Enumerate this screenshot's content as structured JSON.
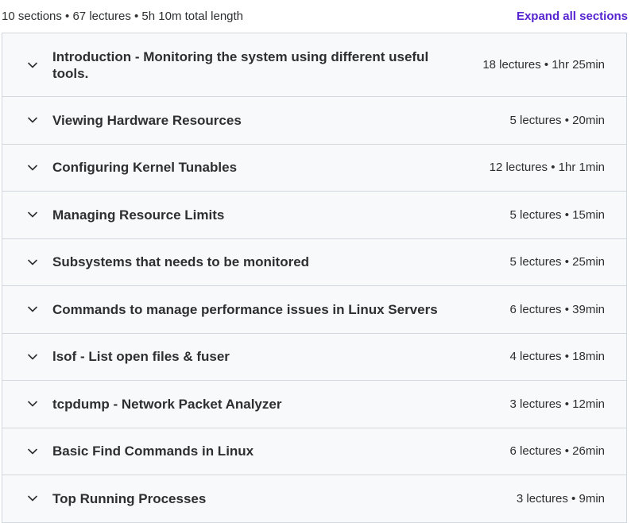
{
  "header": {
    "stats": "10 sections • 67 lectures • 5h 10m total length",
    "expand_label": "Expand all sections"
  },
  "sections": [
    {
      "title": "Introduction - Monitoring the system using different useful tools.",
      "meta": "18 lectures • 1hr 25min"
    },
    {
      "title": "Viewing Hardware Resources",
      "meta": "5 lectures • 20min"
    },
    {
      "title": "Configuring Kernel Tunables",
      "meta": "12 lectures • 1hr 1min"
    },
    {
      "title": "Managing Resource Limits",
      "meta": "5 lectures • 15min"
    },
    {
      "title": "Subsystems that needs to be monitored",
      "meta": "5 lectures • 25min"
    },
    {
      "title": "Commands to manage performance issues in Linux Servers",
      "meta": "6 lectures • 39min"
    },
    {
      "title": "lsof - List open files & fuser",
      "meta": "4 lectures • 18min"
    },
    {
      "title": "tcpdump - Network Packet Analyzer",
      "meta": "3 lectures • 12min"
    },
    {
      "title": "Basic Find Commands in Linux",
      "meta": "6 lectures • 26min"
    },
    {
      "title": "Top Running Processes",
      "meta": "3 lectures • 9min"
    }
  ],
  "icons": {
    "section_toggle": "chevron-down-icon"
  },
  "colors": {
    "accent": "#5624d0",
    "row_background": "#f7f9fa",
    "border": "#d1d7dc",
    "text": "#2d2f31"
  }
}
